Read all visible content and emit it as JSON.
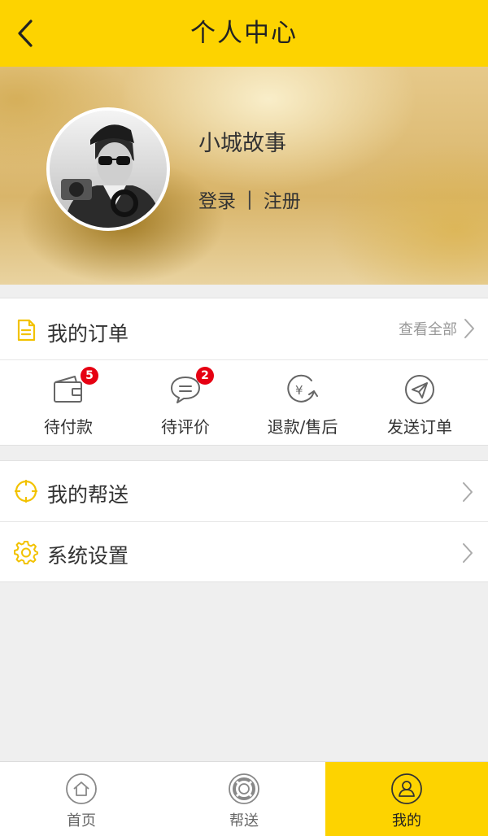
{
  "header": {
    "title": "个人中心",
    "back_icon": "chevron-left-icon"
  },
  "profile": {
    "username": "小城故事",
    "login_label": "登录",
    "separator": "|",
    "register_label": "注册"
  },
  "orders": {
    "title": "我的订单",
    "view_all_label": "查看全部",
    "items": [
      {
        "label": "待付款",
        "icon": "wallet-icon",
        "badge": "5"
      },
      {
        "label": "待评价",
        "icon": "comment-icon",
        "badge": "2"
      },
      {
        "label": "退款/售后",
        "icon": "refund-icon"
      },
      {
        "label": "发送订单",
        "icon": "send-icon"
      }
    ]
  },
  "menu": [
    {
      "label": "我的帮送",
      "icon": "target-icon"
    },
    {
      "label": "系统设置",
      "icon": "gear-icon"
    }
  ],
  "tabbar": [
    {
      "label": "首页",
      "icon": "home-icon"
    },
    {
      "label": "帮送",
      "icon": "lifebuoy-icon"
    },
    {
      "label": "我的",
      "icon": "user-icon",
      "active": true
    }
  ],
  "colors": {
    "accent": "#fdd300",
    "badge": "#e60012"
  }
}
